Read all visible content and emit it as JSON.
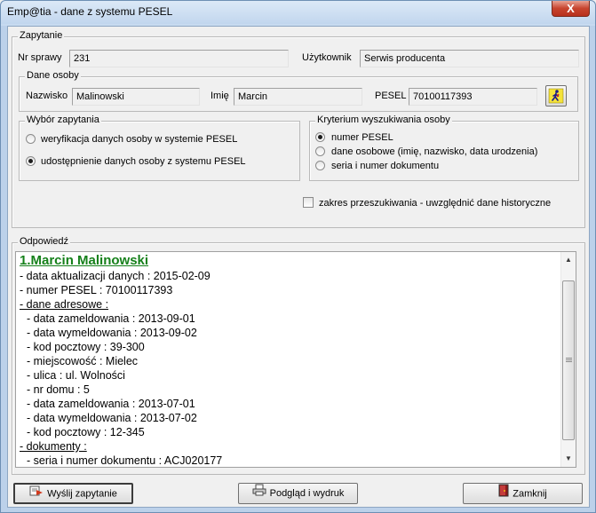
{
  "window": {
    "title": "Emp@tia - dane z systemu PESEL",
    "close_label": "X"
  },
  "zapytanie": {
    "legend": "Zapytanie",
    "nr_sprawy_label": "Nr sprawy",
    "nr_sprawy_value": "231",
    "uzytkownik_label": "Użytkownik",
    "uzytkownik_value": "Serwis producenta"
  },
  "dane_osoby": {
    "legend": "Dane osoby",
    "nazwisko_label": "Nazwisko",
    "nazwisko_value": "Malinowski",
    "imie_label": "Imię",
    "imie_value": "Marcin",
    "pesel_label": "PESEL",
    "pesel_value": "70100117393",
    "search_icon": "person-walking-icon"
  },
  "wybor_zapytania": {
    "legend": "Wybór zapytania",
    "options": [
      {
        "label": "weryfikacja danych osoby w systemie PESEL",
        "selected": false
      },
      {
        "label": "udostępnienie danych osoby z systemu PESEL",
        "selected": true
      }
    ]
  },
  "kryterium": {
    "legend": "Kryterium wyszukiwania osoby",
    "options": [
      {
        "label": "numer PESEL",
        "selected": true
      },
      {
        "label": "dane osobowe (imię, nazwisko, data urodzenia)",
        "selected": false
      },
      {
        "label": "seria i numer dokumentu",
        "selected": false
      }
    ]
  },
  "historyczne": {
    "label": "zakres przeszukiwania - uwzględnić dane historyczne",
    "checked": false
  },
  "odpowiedz": {
    "legend": "Odpowiedź",
    "title": "1.Marcin Malinowski",
    "lines": [
      {
        "text": "- data aktualizacji danych : 2015-02-09",
        "indent": 0,
        "underline": false
      },
      {
        "text": "- numer PESEL : 70100117393",
        "indent": 0,
        "underline": false
      },
      {
        "text": "- dane adresowe :",
        "indent": 0,
        "underline": true
      },
      {
        "text": "- data zameldowania : 2013-09-01",
        "indent": 1,
        "underline": false
      },
      {
        "text": "- data wymeldowania : 2013-09-02",
        "indent": 1,
        "underline": false
      },
      {
        "text": "- kod pocztowy : 39-300",
        "indent": 1,
        "underline": false
      },
      {
        "text": "- miejscowość : Mielec",
        "indent": 1,
        "underline": false
      },
      {
        "text": "- ulica : ul. Wolności",
        "indent": 1,
        "underline": false
      },
      {
        "text": "- nr domu : 5",
        "indent": 1,
        "underline": false
      },
      {
        "text": "- data zameldowania : 2013-07-01",
        "indent": 1,
        "underline": false
      },
      {
        "text": "- data wymeldowania : 2013-07-02",
        "indent": 1,
        "underline": false
      },
      {
        "text": "- kod pocztowy : 12-345",
        "indent": 1,
        "underline": false
      },
      {
        "text": "- dokumenty :",
        "indent": 0,
        "underline": true
      },
      {
        "text": "- seria i numer dokumentu : ACJ020177",
        "indent": 1,
        "underline": false
      }
    ]
  },
  "buttons": {
    "send": "Wyślij zapytanie",
    "preview": "Podgląd i wydruk",
    "close": "Zamknij"
  }
}
